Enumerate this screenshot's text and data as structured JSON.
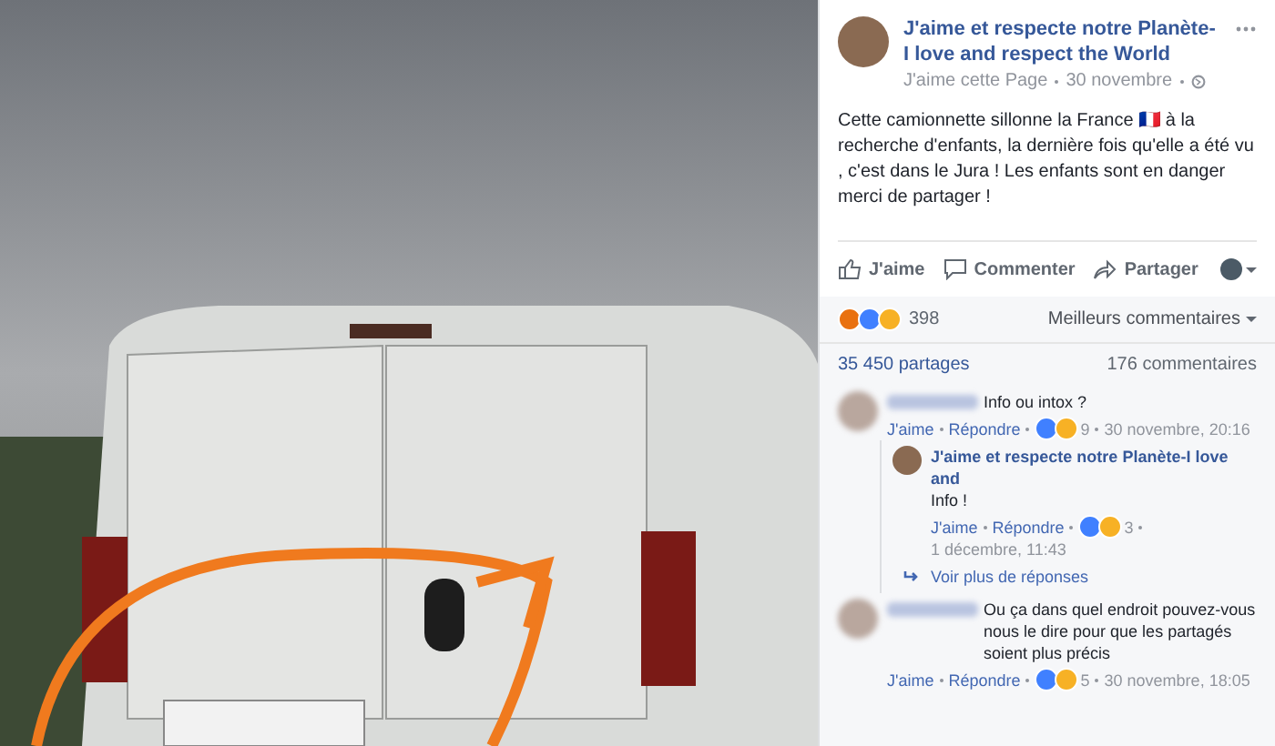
{
  "post": {
    "page_name": "J'aime et respecte notre Planète-I love and respect the World",
    "follow": "J'aime cette Page",
    "date": "30 novembre",
    "text": "Cette camionnette sillonne la France 🇫🇷 à la recherche d'enfants, la dernière fois qu'elle a été vu , c'est dans le Jura ! Les enfants sont en danger merci de partager !"
  },
  "actions": [
    "J'aime",
    "Commenter",
    "Partager"
  ],
  "summary": {
    "reactions": [
      {
        "color": "#e9710f"
      },
      {
        "color": "#4080ff"
      },
      {
        "color": "#f7b125"
      }
    ],
    "reaction_count": "398",
    "sort": "Meilleurs commentaires",
    "shares": "35 450 partages",
    "comments": "176 commentaires"
  },
  "comments": [
    {
      "text": "Info ou intox ?",
      "like": "J'aime",
      "reply": "Répondre",
      "reactions": [
        {
          "color": "#4080ff"
        },
        {
          "color": "#f7b125"
        }
      ],
      "count": "9",
      "date": "30 novembre, 20:16",
      "replies": [
        {
          "author": "J'aime et respecte notre Planète-I love and",
          "text": "Info !",
          "like": "J'aime",
          "reply": "Répondre",
          "reactions": [
            {
              "color": "#4080ff"
            },
            {
              "color": "#f7b125"
            }
          ],
          "count": "3",
          "date": "1 décembre, 11:43"
        }
      ],
      "more_replies": "Voir plus de réponses"
    },
    {
      "text": "Ou ça dans quel endroit pouvez-vous nous le dire pour que les partagés soient plus précis",
      "like": "J'aime",
      "reply": "Répondre",
      "reactions": [
        {
          "color": "#4080ff"
        },
        {
          "color": "#f7b125"
        }
      ],
      "count": "5",
      "date": "30 novembre, 18:05"
    }
  ]
}
